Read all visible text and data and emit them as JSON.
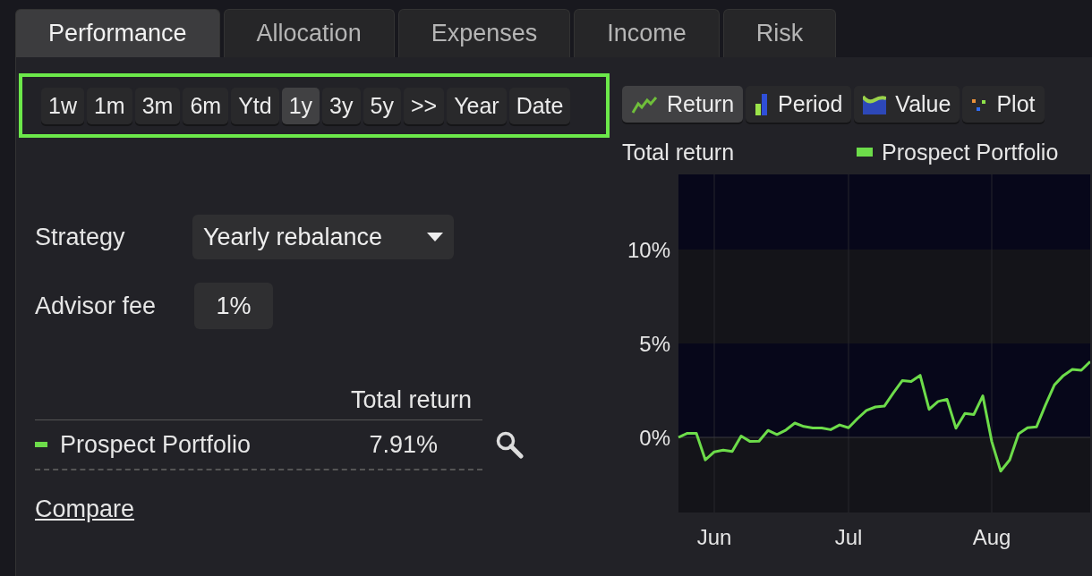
{
  "tabs": [
    {
      "label": "Performance",
      "selected": true
    },
    {
      "label": "Allocation",
      "selected": false
    },
    {
      "label": "Expenses",
      "selected": false
    },
    {
      "label": "Income",
      "selected": false
    },
    {
      "label": "Risk",
      "selected": false
    }
  ],
  "ranges": [
    {
      "label": "1w",
      "selected": false
    },
    {
      "label": "1m",
      "selected": false
    },
    {
      "label": "3m",
      "selected": false
    },
    {
      "label": "6m",
      "selected": false
    },
    {
      "label": "Ytd",
      "selected": false
    },
    {
      "label": "1y",
      "selected": true
    },
    {
      "label": "3y",
      "selected": false
    },
    {
      "label": "5y",
      "selected": false
    },
    {
      "label": ">>",
      "selected": false
    },
    {
      "label": "Year",
      "selected": false
    },
    {
      "label": "Date",
      "selected": false
    }
  ],
  "strategy": {
    "label": "Strategy",
    "value": "Yearly rebalance"
  },
  "advisor_fee": {
    "label": "Advisor fee",
    "value": "1%"
  },
  "results": {
    "column": "Total return",
    "rows": [
      {
        "name": "Prospect Portfolio",
        "value": "7.91%",
        "color": "#6ddc4a"
      }
    ]
  },
  "compare_link": "Compare",
  "chart_types": [
    {
      "label": "Return",
      "kind": "line",
      "selected": true
    },
    {
      "label": "Period",
      "kind": "bar",
      "selected": false
    },
    {
      "label": "Value",
      "kind": "area",
      "selected": false
    },
    {
      "label": "Plot",
      "kind": "scatter",
      "selected": false
    }
  ],
  "chart": {
    "chart_data": {
      "type": "line",
      "title": "Total return",
      "categories": [
        null,
        null,
        null,
        null,
        "Jun",
        null,
        null,
        null,
        null,
        null,
        null,
        null,
        null,
        null,
        null,
        null,
        null,
        null,
        null,
        "Jul",
        null,
        null,
        null,
        null,
        null,
        null,
        null,
        null,
        null,
        null,
        null,
        null,
        null,
        null,
        null,
        "Aug",
        null,
        null,
        null,
        null,
        null,
        null,
        null,
        null,
        null,
        null,
        null
      ],
      "series": [
        {
          "name": "Prospect Portfolio",
          "color": "#6ddc4a",
          "values": [
            0,
            0.22,
            0.22,
            -1.2,
            -0.77,
            -0.68,
            -0.75,
            0.07,
            -0.22,
            -0.2,
            0.37,
            0.15,
            0.39,
            0.76,
            0.58,
            0.5,
            0.5,
            0.41,
            0.66,
            0.51,
            1.0,
            1.44,
            1.62,
            1.66,
            2.36,
            3.02,
            2.97,
            3.3,
            1.49,
            1.91,
            2.03,
            0.49,
            1.27,
            1.22,
            2.21,
            -0.22,
            -1.8,
            -1.2,
            0.19,
            0.51,
            0.56,
            1.72,
            2.79,
            3.29,
            3.62,
            3.57,
            4.04
          ]
        }
      ],
      "ylim": [
        -4,
        14
      ],
      "grid": true,
      "yticks": [
        {
          "value": 0,
          "label": "0%"
        },
        {
          "value": 5,
          "label": "5%"
        },
        {
          "value": 10,
          "label": "10%"
        }
      ]
    }
  }
}
